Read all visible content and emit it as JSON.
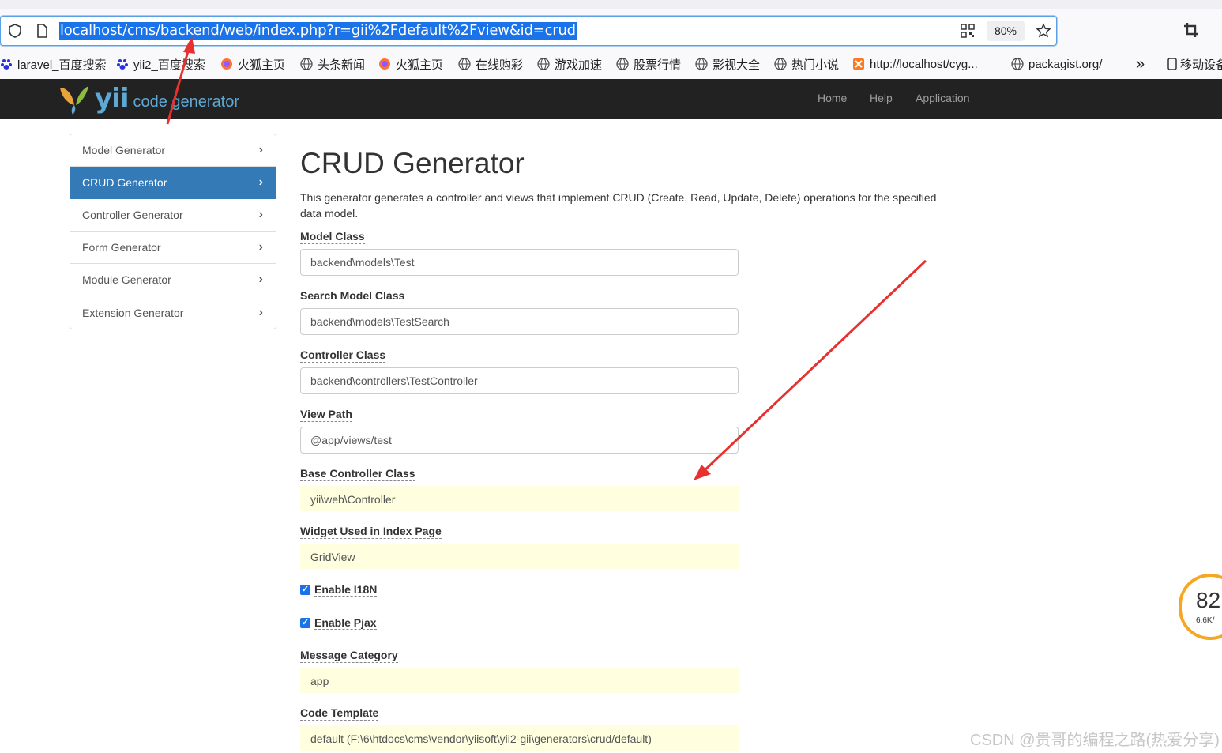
{
  "browser": {
    "url": "localhost/cms/backend/web/index.php?r=gii%2Fdefault%2Fview&id=crud",
    "zoom": "80%",
    "bookmarks": [
      {
        "label": "laravel_百度搜索",
        "icon": "baidu-icon"
      },
      {
        "label": "yii2_百度搜索",
        "icon": "baidu-icon"
      },
      {
        "label": "火狐主页",
        "icon": "firefox-icon"
      },
      {
        "label": "头条新闻",
        "icon": "globe-icon"
      },
      {
        "label": "火狐主页",
        "icon": "firefox-icon"
      },
      {
        "label": "在线购彩",
        "icon": "globe-icon"
      },
      {
        "label": "游戏加速",
        "icon": "globe-icon"
      },
      {
        "label": "股票行情",
        "icon": "globe-icon"
      },
      {
        "label": "影视大全",
        "icon": "globe-icon"
      },
      {
        "label": "热门小说",
        "icon": "globe-icon"
      },
      {
        "label": "http://localhost/cyg...",
        "icon": "xampp-icon"
      },
      {
        "label": "packagist.org/",
        "icon": "globe-icon"
      }
    ],
    "more_label": "»",
    "mobile_label": "移动设备"
  },
  "navbar": {
    "logo_text": "yii",
    "logo_sub": "code generator",
    "links": [
      "Home",
      "Help",
      "Application"
    ]
  },
  "sidebar": {
    "items": [
      {
        "label": "Model Generator"
      },
      {
        "label": "CRUD Generator"
      },
      {
        "label": "Controller Generator"
      },
      {
        "label": "Form Generator"
      },
      {
        "label": "Module Generator"
      },
      {
        "label": "Extension Generator"
      }
    ],
    "chevron": "›"
  },
  "main": {
    "title": "CRUD Generator",
    "description": "This generator generates a controller and views that implement CRUD (Create, Read, Update, Delete) operations for the specified data model.",
    "fields": [
      {
        "label": "Model Class",
        "value": "backend\\models\\Test"
      },
      {
        "label": "Search Model Class",
        "value": "backend\\models\\TestSearch"
      },
      {
        "label": "Controller Class",
        "value": "backend\\controllers\\TestController"
      },
      {
        "label": "View Path",
        "value": "@app/views/test"
      },
      {
        "label": "Base Controller Class",
        "value": "yii\\web\\Controller"
      },
      {
        "label": "Widget Used in Index Page",
        "value": "GridView"
      },
      {
        "label": "Message Category",
        "value": "app"
      },
      {
        "label": "Code Template",
        "value": "default (F:\\6\\htdocs\\cms\\vendor\\yiisoft\\yii2-gii\\generators\\crud/default)"
      }
    ],
    "checkboxes": [
      {
        "label": "Enable I18N",
        "checked": true
      },
      {
        "label": "Enable Pjax",
        "checked": true
      }
    ]
  },
  "overlay": {
    "speed_value": "82",
    "speed_sub": "6.6K/",
    "watermark": "CSDN @贵哥的编程之路(热爱分享)"
  },
  "colors": {
    "navbar_bg": "#222222",
    "active_item": "#337ab7",
    "sticky_input": "#ffffe0",
    "annotation_arrow": "#e8312f"
  }
}
